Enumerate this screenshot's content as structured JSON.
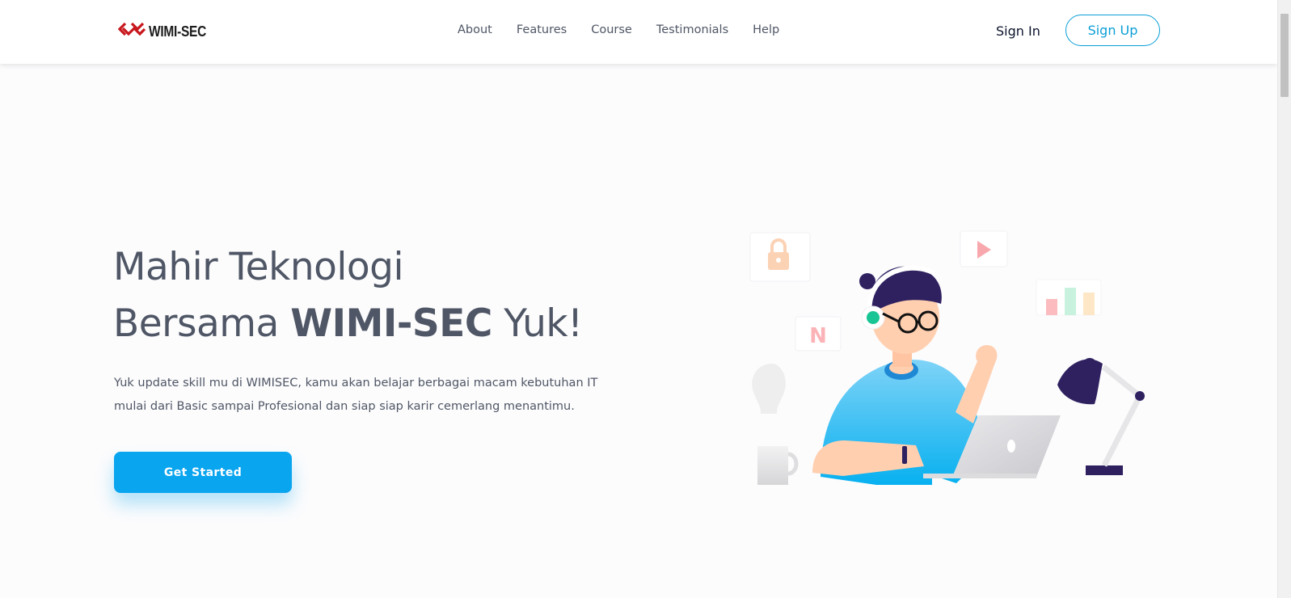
{
  "brand": {
    "name": "WIMI-SEC"
  },
  "nav": {
    "items": [
      {
        "label": "About"
      },
      {
        "label": "Features"
      },
      {
        "label": "Course"
      },
      {
        "label": "Testimonials"
      },
      {
        "label": "Help"
      }
    ]
  },
  "auth": {
    "sign_in": "Sign In",
    "sign_up": "Sign Up"
  },
  "hero": {
    "title_line1": "Mahir Teknologi",
    "title_line2_prefix": "Bersama ",
    "title_line2_brand": "WIMI-SEC",
    "title_line2_suffix": " Yuk!",
    "description_line1": "Yuk update skill mu di WIMISEC, kamu akan belajar berbagai macam kebutuhan IT",
    "description_line2": "mulai dari Basic sampai Profesional dan siap siap karir cemerlang menantimu.",
    "cta_label": "Get Started"
  },
  "illustration": {
    "floating_card_letter": "N",
    "icons": [
      "lock-icon",
      "play-icon",
      "bar-chart-icon",
      "lightbulb-icon",
      "mug-icon",
      "desk-lamp-icon",
      "laptop-icon"
    ]
  },
  "colors": {
    "accent": "#0aa5ef",
    "sign_up_border": "#0a9ed6",
    "text": "#4f5665",
    "logo_red": "#c8181e"
  }
}
